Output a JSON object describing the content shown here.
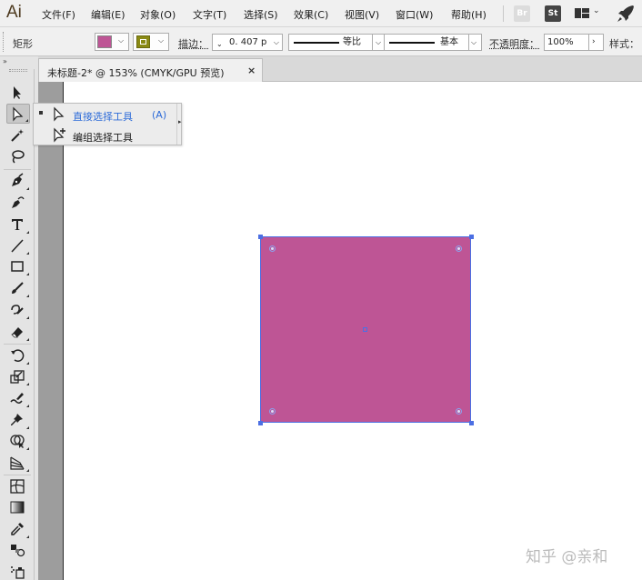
{
  "app": {
    "logo": "Ai"
  },
  "menu": {
    "items": [
      {
        "label": "文件(F)"
      },
      {
        "label": "编辑(E)"
      },
      {
        "label": "对象(O)"
      },
      {
        "label": "文字(T)"
      },
      {
        "label": "选择(S)"
      },
      {
        "label": "效果(C)"
      },
      {
        "label": "视图(V)"
      },
      {
        "label": "窗口(W)"
      },
      {
        "label": "帮助(H)"
      }
    ],
    "bridge_label": "Br",
    "stock_label": "St",
    "workspace_icon": "workspace-switcher-icon",
    "gpu_icon": "rocket-icon"
  },
  "control": {
    "object_type": "矩形",
    "fill_color": "#be5595",
    "stroke_color": "#8a8a14",
    "stroke_label": "描边：",
    "stroke_weight": "0. 407 p",
    "variable_width_profile": "等比",
    "brush_definition": "基本",
    "opacity_label": "不透明度：",
    "opacity_value": "100%",
    "style_label": "样式："
  },
  "tools": {
    "panel_toggle": "»",
    "items": [
      {
        "name": "selection-tool",
        "icon": "selection-arrow-icon",
        "active": false
      },
      {
        "name": "direct-selection-tool",
        "icon": "direct-selection-arrow-icon",
        "active": true
      },
      {
        "name": "magic-wand-tool",
        "icon": "magic-wand-icon",
        "active": false
      },
      {
        "name": "lasso-tool",
        "icon": "lasso-icon",
        "active": false
      },
      {
        "name": "pen-tool",
        "icon": "pen-icon",
        "active": false
      },
      {
        "name": "curvature-tool",
        "icon": "curvature-pen-icon",
        "active": false
      },
      {
        "name": "type-tool",
        "icon": "type-t-icon",
        "active": false
      },
      {
        "name": "line-segment-tool",
        "icon": "line-icon",
        "active": false
      },
      {
        "name": "rectangle-tool",
        "icon": "rectangle-icon",
        "active": false
      },
      {
        "name": "paintbrush-tool",
        "icon": "paintbrush-icon",
        "active": false
      },
      {
        "name": "shaper-tool",
        "icon": "shaper-icon",
        "active": false
      },
      {
        "name": "eraser-tool",
        "icon": "eraser-icon",
        "active": false
      },
      {
        "name": "rotate-tool",
        "icon": "rotate-icon",
        "active": false
      },
      {
        "name": "scale-tool",
        "icon": "scale-icon",
        "active": false
      },
      {
        "name": "warp-tool",
        "icon": "warp-icon",
        "active": false
      },
      {
        "name": "puppet-warp-tool",
        "icon": "pushpin-icon",
        "active": false
      },
      {
        "name": "shape-builder-tool",
        "icon": "shape-builder-icon",
        "active": false
      },
      {
        "name": "perspective-grid-tool",
        "icon": "perspective-grid-icon",
        "active": false
      },
      {
        "name": "mesh-tool",
        "icon": "mesh-icon",
        "active": false
      },
      {
        "name": "gradient-tool",
        "icon": "gradient-icon",
        "active": false
      },
      {
        "name": "eyedropper-tool",
        "icon": "eyedropper-icon",
        "active": false
      },
      {
        "name": "blend-tool",
        "icon": "blend-icon",
        "active": false
      },
      {
        "name": "symbol-sprayer-tool",
        "icon": "symbol-sprayer-icon",
        "active": false
      }
    ]
  },
  "document": {
    "tab_title": "未标题-2* @ 153% (CMYK/GPU 预览)",
    "close_glyph": "×"
  },
  "flyout": {
    "items": [
      {
        "label": "直接选择工具",
        "shortcut": "(A)",
        "selected": true,
        "icon": "direct-selection-arrow-icon",
        "color": "#2d6bd8"
      },
      {
        "label": "编组选择工具",
        "shortcut": "",
        "selected": false,
        "icon": "group-selection-arrow-icon",
        "color": "#1a1a1a"
      }
    ],
    "tearoff_glyph": "▸"
  },
  "canvas": {
    "shape_fill": "#be5595",
    "selection_color": "#4c6fe3"
  },
  "watermark": "知乎 @亲和"
}
